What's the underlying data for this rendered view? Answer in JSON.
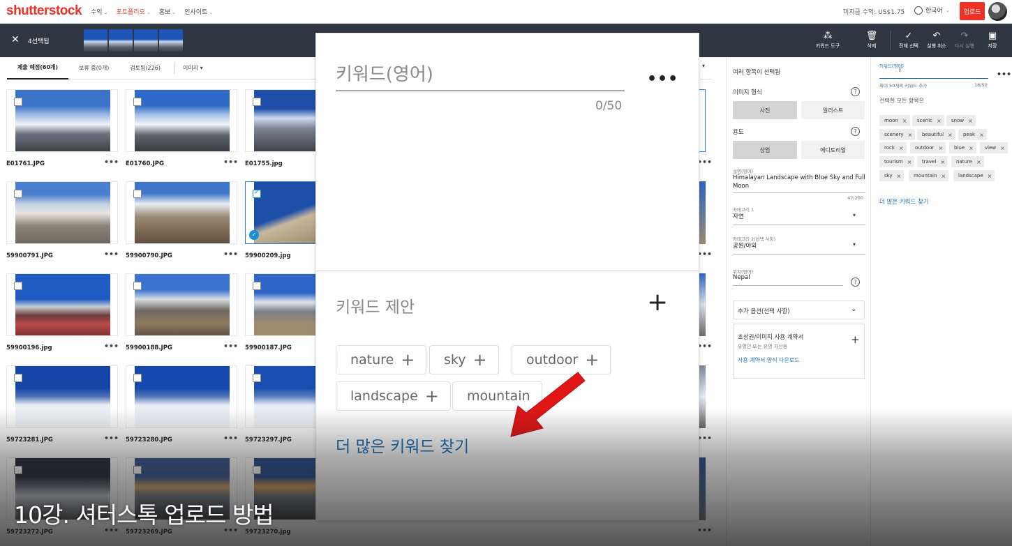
{
  "topnav": {
    "logo": "shutterstock",
    "links": [
      {
        "label": "수익",
        "active": false
      },
      {
        "label": "포트폴리오",
        "active": true
      },
      {
        "label": "홍보",
        "active": false
      },
      {
        "label": "인사이트",
        "active": false
      }
    ],
    "earnings": "미지급 수익: US$1.75",
    "language": "한국어",
    "upload": "업로드"
  },
  "selection_bar": {
    "count_label": "4선택됨",
    "tools": {
      "keyword_tool": "키워드 도구",
      "delete": "삭제",
      "select_all": "전체 선택",
      "undo": "실행 취소",
      "redo": "다시 실행",
      "save": "저장"
    }
  },
  "tabs": {
    "submit": "제출 예정(60개)",
    "pending": "보류 중(0개)",
    "reviewed": "검토됨(226)",
    "type_dropdown": "이미지"
  },
  "files": {
    "r1": [
      "E01761.JPG",
      "E01760.JPG",
      "E01755.jpg"
    ],
    "r2": [
      "59900791.JPG",
      "59900790.JPG",
      "59900209.jpg"
    ],
    "r3": [
      "59900196.jpg",
      "59900188.JPG",
      "59900187.JPG"
    ],
    "r4": [
      "59723281.JPG",
      "59723280.JPG",
      "59723297.JPG"
    ],
    "r5": [
      "59723272.JPG",
      "59723269.JPG",
      "59723270.jpg"
    ]
  },
  "zoom": {
    "keyword_label": "키워드(영어)",
    "count": "0/50",
    "more": "•••",
    "suggestion_title": "키워드 제안",
    "chips": [
      "nature",
      "sky",
      "outdoor",
      "landscape",
      "mountain"
    ],
    "find_more": "더 많은 키워드 찾기"
  },
  "panel": {
    "multi_selected": "여러 항목이 선택됨",
    "image_type_label": "이미지 형식",
    "photo": "사진",
    "illustration": "일러스트",
    "usage_label": "용도",
    "commercial": "상업",
    "editorial": "에디토리얼",
    "description_label": "설명(영어)",
    "description_value": "Himalayan Landscape with Blue Sky and Full Moon",
    "description_count": "47/200",
    "category1_label": "카테고리 1",
    "category1_value": "자연",
    "category2_label": "카테고리 2(선택 사항)",
    "category2_value": "공원/야외",
    "location_label": "위치(영어)",
    "location_value": "Nepal",
    "extra_options": "추가 옵션(선택 사항)",
    "release_title": "초상권/이미지 사용 계약서",
    "release_sub": "유명인 또는 유명 자산용",
    "release_link": "사용 계약서 양식 다운로드"
  },
  "keywords": {
    "label": "키워드(영어)",
    "hint": "최대 50개의 키워드 추가",
    "count": "16/50",
    "all_items": "선택한 모든 항목은",
    "chips": [
      "moon",
      "scenic",
      "snow",
      "scenery",
      "beautiful",
      "peak",
      "rock",
      "outdoor",
      "blue",
      "view",
      "tourism",
      "travel",
      "nature",
      "sky",
      "mountain",
      "landscape"
    ],
    "find_more": "더 많은 키워드 찾기"
  },
  "caption": "10강. 셔터스톡 업로드 방법",
  "colors": {
    "brand_red": "#ee3124",
    "link_blue": "#1a6fb8",
    "dark_bar": "#2f3742"
  }
}
